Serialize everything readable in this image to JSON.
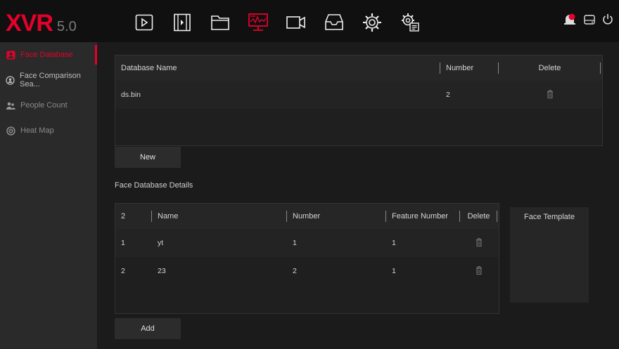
{
  "app": {
    "logo": "XVR",
    "version": "5.0"
  },
  "topnav": [
    {
      "icon": "playback-icon"
    },
    {
      "icon": "film-icon"
    },
    {
      "icon": "folder-icon"
    },
    {
      "icon": "monitor-chart-icon",
      "active": true
    },
    {
      "icon": "camera-icon"
    },
    {
      "icon": "storage-icon"
    },
    {
      "icon": "gear-icon"
    },
    {
      "icon": "settings-list-icon"
    }
  ],
  "topright": [
    {
      "icon": "alarm-icon",
      "badge": "8"
    },
    {
      "icon": "disk-icon"
    },
    {
      "icon": "power-icon"
    }
  ],
  "sidebar": {
    "items": [
      {
        "label": "Face Database",
        "icon": "face-icon"
      },
      {
        "label": "Face Comparison Sea...",
        "icon": "face-search-icon"
      },
      {
        "label": "People Count",
        "icon": "people-icon"
      },
      {
        "label": "Heat Map",
        "icon": "heatmap-icon"
      }
    ]
  },
  "database": {
    "headers": {
      "name": "Database Name",
      "number": "Number",
      "delete": "Delete"
    },
    "rows": [
      {
        "name": "ds.bin",
        "number": "2"
      }
    ],
    "new_label": "New"
  },
  "details": {
    "title": "Face Database Details",
    "headers": {
      "count": "2",
      "name": "Name",
      "number": "Number",
      "feature": "Feature Number",
      "delete": "Delete"
    },
    "rows": [
      {
        "idx": "1",
        "name": "yt",
        "number": "1",
        "feature": "1"
      },
      {
        "idx": "2",
        "name": "23",
        "number": "2",
        "feature": "1"
      }
    ],
    "add_label": "Add",
    "template_label": "Face Template"
  },
  "colors": {
    "accent": "#e6002a",
    "background": "#1b1b1b",
    "sidebar": "#2a2a2a"
  }
}
